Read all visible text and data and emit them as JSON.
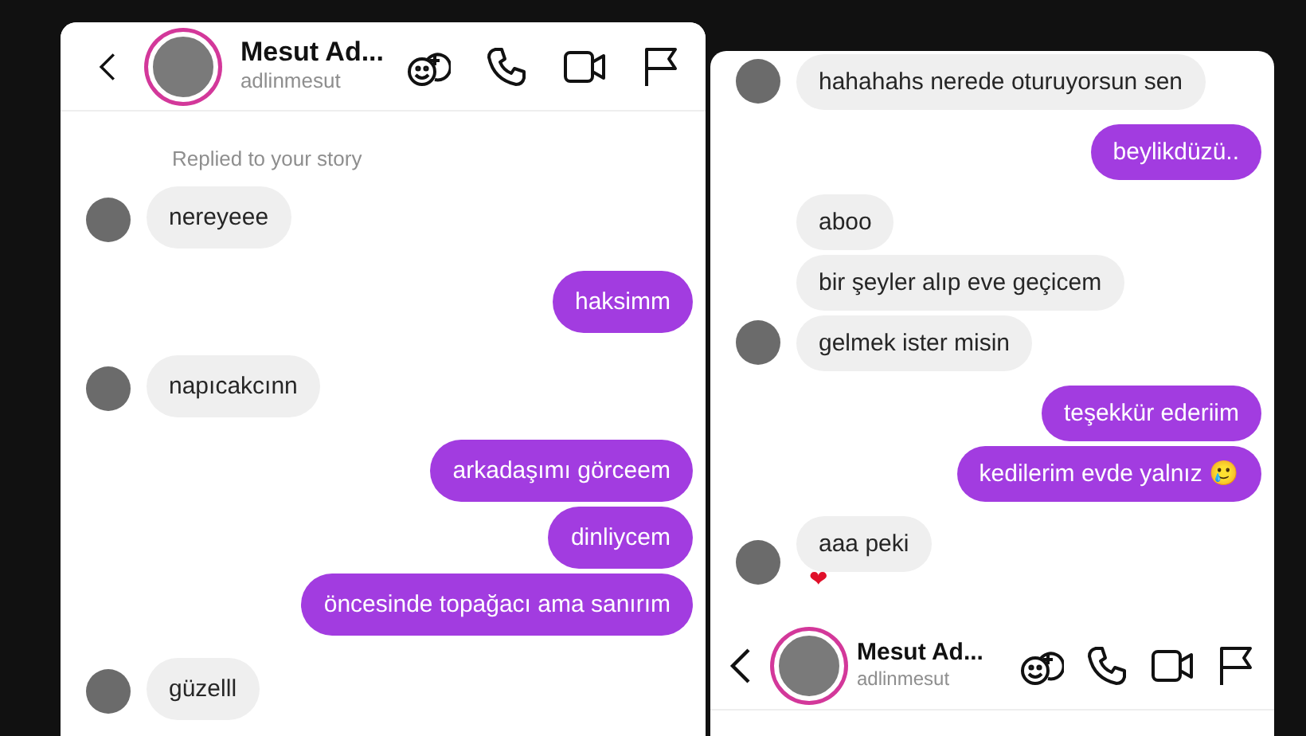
{
  "panels": [
    {
      "header": {
        "name": "Mesut Ad...",
        "username": "adlinmesut"
      },
      "notice": "Replied to your story",
      "messages": [
        {
          "kind": "received",
          "text": "nereyeee",
          "avatar": true
        },
        {
          "kind": "sent",
          "text": "haksimm"
        },
        {
          "kind": "received",
          "text": "napıcakcınn",
          "avatar": true
        },
        {
          "kind": "sent",
          "text": "arkadaşımı görceem"
        },
        {
          "kind": "sent",
          "text": "dinliycem"
        },
        {
          "kind": "sent",
          "text": "öncesinde topağacı ama sanırım"
        },
        {
          "kind": "received",
          "text": "güzelll",
          "avatar": true
        }
      ]
    },
    {
      "messages": [
        {
          "kind": "received",
          "text": "hahahahs nerede oturuyorsun sen",
          "avatar": true
        },
        {
          "kind": "sent",
          "text": "beylikdüzü.."
        },
        {
          "kind": "received",
          "text": "aboo",
          "avatar": false
        },
        {
          "kind": "received",
          "text": "bir şeyler alıp eve geçicem",
          "avatar": false
        },
        {
          "kind": "received",
          "text": "gelmek ister misin",
          "avatar": true
        },
        {
          "kind": "sent",
          "text": "teşekkür ederiim"
        },
        {
          "kind": "sent",
          "text": "kedilerim evde yalnız 🥲"
        },
        {
          "kind": "received",
          "text": "aaa peki",
          "avatar": true,
          "reaction": "❤"
        }
      ],
      "bottom_bar": {
        "name": "Mesut Ad...",
        "username": "adlinmesut"
      }
    }
  ]
}
